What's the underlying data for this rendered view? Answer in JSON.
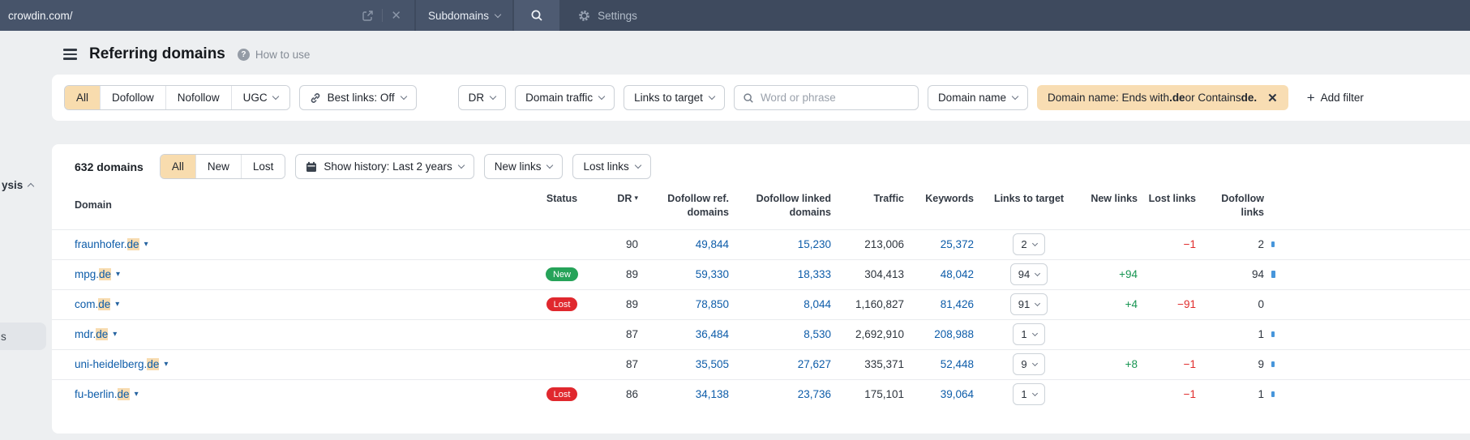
{
  "topbar": {
    "url": "crowdin.com/",
    "mode": "Subdomains",
    "settings": "Settings"
  },
  "sidebar": {
    "collapsed_item_partial": "ysis",
    "selected_item_partial": "s"
  },
  "header": {
    "title": "Referring domains",
    "help": "How to use"
  },
  "filters": {
    "segments": [
      "All",
      "Dofollow",
      "Nofollow",
      "UGC"
    ],
    "active_segment": "All",
    "best_links": "Best links: Off",
    "dr": "DR",
    "domain_traffic": "Domain traffic",
    "links_to_target": "Links to target",
    "search_placeholder": "Word or phrase",
    "domain_name": "Domain name",
    "chip": {
      "t1": "Domain name: Ends with ",
      "b1": ".de",
      "t2": " or Contains ",
      "b2": "de."
    },
    "add_filter": "Add filter"
  },
  "toolbar": {
    "count": "632 domains",
    "segments": [
      "All",
      "New",
      "Lost"
    ],
    "active_segment": "All",
    "show_history": "Show history: Last 2 years",
    "new_links": "New links",
    "lost_links": "Lost links"
  },
  "table": {
    "columns": [
      "Domain",
      "Status",
      "DR",
      "Dofollow ref.\ndomains",
      "Dofollow linked\ndomains",
      "Traffic",
      "Keywords",
      "Links to target",
      "New links",
      "Lost links",
      "Dofollow\nlinks"
    ],
    "rows": [
      {
        "domain": "fraunhofer.",
        "tld": "de",
        "status": "",
        "dr": "90",
        "dofollow_ref": "49,844",
        "dofollow_linked": "15,230",
        "traffic": "213,006",
        "keywords": "25,372",
        "links_to_target": "2",
        "new_links": "",
        "lost_links": "−1",
        "dofollow_links": "2"
      },
      {
        "domain": "mpg.",
        "tld": "de",
        "status": "New",
        "dr": "89",
        "dofollow_ref": "59,330",
        "dofollow_linked": "18,333",
        "traffic": "304,413",
        "keywords": "48,042",
        "links_to_target": "94",
        "new_links": "+94",
        "lost_links": "",
        "dofollow_links": "94"
      },
      {
        "domain": "com.",
        "tld": "de",
        "status": "Lost",
        "dr": "89",
        "dofollow_ref": "78,850",
        "dofollow_linked": "8,044",
        "traffic": "1,160,827",
        "keywords": "81,426",
        "links_to_target": "91",
        "new_links": "+4",
        "lost_links": "−91",
        "dofollow_links": "0"
      },
      {
        "domain": "mdr.",
        "tld": "de",
        "status": "",
        "dr": "87",
        "dofollow_ref": "36,484",
        "dofollow_linked": "8,530",
        "traffic": "2,692,910",
        "keywords": "208,988",
        "links_to_target": "1",
        "new_links": "",
        "lost_links": "",
        "dofollow_links": "1"
      },
      {
        "domain": "uni-heidelberg.",
        "tld": "de",
        "status": "",
        "dr": "87",
        "dofollow_ref": "35,505",
        "dofollow_linked": "27,627",
        "traffic": "335,371",
        "keywords": "52,448",
        "links_to_target": "9",
        "new_links": "+8",
        "lost_links": "−1",
        "dofollow_links": "9"
      },
      {
        "domain": "fu-berlin.",
        "tld": "de",
        "status": "Lost",
        "dr": "86",
        "dofollow_ref": "34,138",
        "dofollow_linked": "23,736",
        "traffic": "175,101",
        "keywords": "39,064",
        "links_to_target": "1",
        "new_links": "",
        "lost_links": "−1",
        "dofollow_links": "1"
      }
    ]
  },
  "colors": {
    "topbar": "#3e4a5e",
    "link": "#0d5ca9",
    "highlight": "#f8dcb0",
    "chip_bg": "#f8ddb3",
    "active_segment_bg": "#f8dcae",
    "badge_new": "#26a359",
    "badge_lost": "#e0282e",
    "positive": "#179552",
    "negative": "#e02b2b",
    "bar": "#4796db"
  }
}
